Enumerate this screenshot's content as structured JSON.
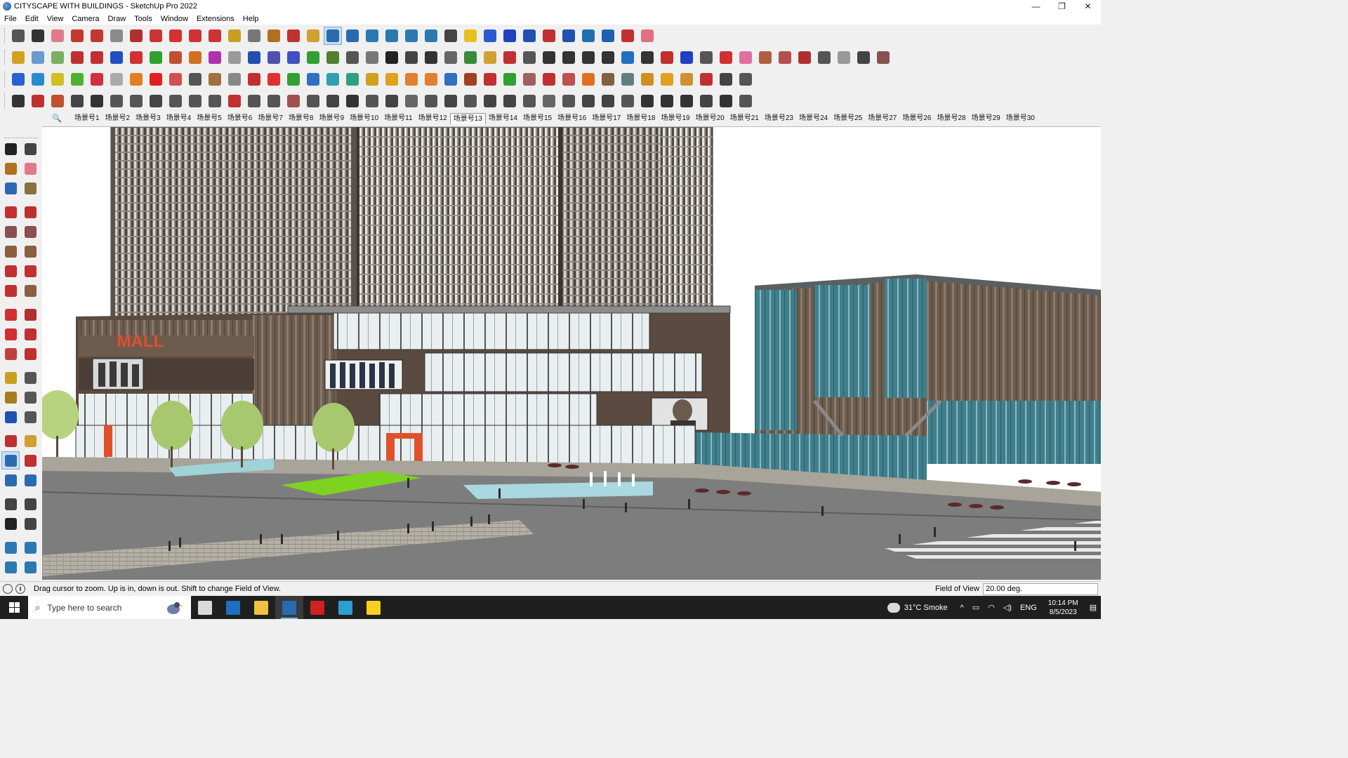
{
  "window": {
    "title": "CITYSCAPE WITH BUILDINGS - SketchUp Pro 2022",
    "minimize": "—",
    "restore": "❐",
    "close": "✕"
  },
  "menu": [
    "File",
    "Edit",
    "View",
    "Camera",
    "Draw",
    "Tools",
    "Window",
    "Extensions",
    "Help"
  ],
  "toolbars": {
    "row1": [
      {
        "name": "zoom-extents-icon",
        "color": "#555555"
      },
      {
        "name": "select-arrow-icon",
        "color": "#333333"
      },
      {
        "name": "eraser-icon",
        "color": "#e07a8a"
      },
      {
        "name": "pencil-icon",
        "color": "#c0392b"
      },
      {
        "name": "lasso-icon",
        "color": "#c0392b"
      },
      {
        "name": "rectangle-icon",
        "color": "#8a8a8a"
      },
      {
        "name": "push-pull-icon",
        "color": "#b03030"
      },
      {
        "name": "follow-me-icon",
        "color": "#cc3333"
      },
      {
        "name": "move-icon",
        "color": "#d63030"
      },
      {
        "name": "rotate-icon",
        "color": "#cc3333"
      },
      {
        "name": "scale-icon",
        "color": "#cc3333"
      },
      {
        "name": "tape-measure-icon",
        "color": "#c8a020"
      },
      {
        "name": "text-icon",
        "color": "#777777"
      },
      {
        "name": "paint-bucket-icon",
        "color": "#b07020"
      },
      {
        "name": "orbit-icon",
        "color": "#c03030"
      },
      {
        "name": "pan-icon",
        "color": "#d0a030"
      },
      {
        "name": "zoom-icon",
        "color": "#2a6ab0"
      },
      {
        "name": "zoom-window-icon",
        "color": "#2a6ab0"
      },
      {
        "name": "warehouse-icon",
        "color": "#2a7ab0"
      },
      {
        "name": "extension-warehouse-icon",
        "color": "#2a7ab0"
      },
      {
        "name": "layout-icon",
        "color": "#2a7ab0"
      },
      {
        "name": "extension-manager-icon",
        "color": "#2a7ab0"
      },
      {
        "name": "user-account-icon",
        "color": "#444444"
      },
      {
        "name": "component-icon",
        "color": "#e8c020"
      },
      {
        "name": "group-icon",
        "color": "#2a5ad0"
      },
      {
        "name": "axes-icon",
        "color": "#2040c0"
      },
      {
        "name": "flip-icon",
        "color": "#2050b0"
      },
      {
        "name": "flip-2-icon",
        "color": "#c03030"
      },
      {
        "name": "dimension-icon",
        "color": "#2050b0"
      },
      {
        "name": "section-plane-icon",
        "color": "#2070b0"
      },
      {
        "name": "undo-icon",
        "color": "#2060b0"
      },
      {
        "name": "redo-icon",
        "color": "#c03030"
      },
      {
        "name": "preferences-icon",
        "color": "#e07080"
      }
    ],
    "row2": [
      {
        "name": "xray-box-icon",
        "color": "#d4a020"
      },
      {
        "name": "back-edges-icon",
        "color": "#6a9ad0"
      },
      {
        "name": "wireframe-box-icon",
        "color": "#7ab060"
      },
      {
        "name": "move-up-icon",
        "color": "#c03030"
      },
      {
        "name": "array-icon",
        "color": "#c03030"
      },
      {
        "name": "array-2-icon",
        "color": "#2050c0"
      },
      {
        "name": "array-r-icon",
        "color": "#d03030"
      },
      {
        "name": "array-g-icon",
        "color": "#30a030"
      },
      {
        "name": "array-n-icon",
        "color": "#c05030"
      },
      {
        "name": "array-x-icon",
        "color": "#d07020"
      },
      {
        "name": "array-f-icon",
        "color": "#b030b0"
      },
      {
        "name": "curve-icon",
        "color": "#999999"
      },
      {
        "name": "wall-icon",
        "color": "#2050b0"
      },
      {
        "name": "wall-2-icon",
        "color": "#5050b0"
      },
      {
        "name": "wall-3-icon",
        "color": "#4050c0"
      },
      {
        "name": "surface-icon",
        "color": "#30a030"
      },
      {
        "name": "terrain-icon",
        "color": "#508030"
      },
      {
        "name": "building-icon",
        "color": "#555555"
      },
      {
        "name": "building-2-icon",
        "color": "#777777"
      },
      {
        "name": "house-icon",
        "color": "#222222"
      },
      {
        "name": "house-2-icon",
        "color": "#444444"
      },
      {
        "name": "house-3-icon",
        "color": "#333333"
      },
      {
        "name": "house-4-icon",
        "color": "#666666"
      },
      {
        "name": "function-icon",
        "color": "#3a8a3a"
      },
      {
        "name": "tag-icon",
        "color": "#d0a030"
      },
      {
        "name": "line-tool-icon",
        "color": "#c03030"
      },
      {
        "name": "shape-icon",
        "color": "#555555"
      },
      {
        "name": "circle-icon",
        "color": "#333333"
      },
      {
        "name": "polygon-icon",
        "color": "#333333"
      },
      {
        "name": "ellipse-icon",
        "color": "#333333"
      },
      {
        "name": "parallelogram-icon",
        "color": "#333333"
      },
      {
        "name": "arc-icon",
        "color": "#2070c0"
      },
      {
        "name": "gear-icon",
        "color": "#333333"
      },
      {
        "name": "ruler-icon",
        "color": "#c03030"
      },
      {
        "name": "spline-icon",
        "color": "#2040c0"
      },
      {
        "name": "spiral-icon",
        "color": "#555555"
      },
      {
        "name": "resize-icon",
        "color": "#d03030"
      },
      {
        "name": "eraser-2-icon",
        "color": "#e070a0"
      },
      {
        "name": "tile-icon",
        "color": "#b06040"
      },
      {
        "name": "grid-icon",
        "color": "#b05050"
      },
      {
        "name": "roof-icon",
        "color": "#b03030"
      },
      {
        "name": "roof-2-icon",
        "color": "#555555"
      },
      {
        "name": "dome-icon",
        "color": "#999999"
      },
      {
        "name": "terrain-2-icon",
        "color": "#444444"
      },
      {
        "name": "terrain-3-icon",
        "color": "#8a5050"
      }
    ],
    "row3": [
      {
        "name": "solid-icon",
        "color": "#2a60d0"
      },
      {
        "name": "plane-icon",
        "color": "#2a8ad0"
      },
      {
        "name": "plane-2-icon",
        "color": "#d0c020"
      },
      {
        "name": "plane-3-icon",
        "color": "#50b030"
      },
      {
        "name": "plane-4-icon",
        "color": "#d03040"
      },
      {
        "name": "plane-5-icon",
        "color": "#aaaaaa"
      },
      {
        "name": "hook-icon",
        "color": "#e08020"
      },
      {
        "name": "stop-icon",
        "color": "#e02020"
      },
      {
        "name": "box-icon",
        "color": "#d05050"
      },
      {
        "name": "flag-icon",
        "color": "#555555"
      },
      {
        "name": "wood-icon",
        "color": "#a07040"
      },
      {
        "name": "bend-icon",
        "color": "#888888"
      },
      {
        "name": "chain-icon",
        "color": "#c03030"
      },
      {
        "name": "cross-red-icon",
        "color": "#e03030"
      },
      {
        "name": "cross-green-icon",
        "color": "#30a030"
      },
      {
        "name": "cross-blue-icon",
        "color": "#3070c0"
      },
      {
        "name": "cone-icon",
        "color": "#30a0b0"
      },
      {
        "name": "cone-2-icon",
        "color": "#30a080"
      },
      {
        "name": "warning-icon",
        "color": "#d0a020"
      },
      {
        "name": "arc-2-icon",
        "color": "#e0a020"
      },
      {
        "name": "arc-3-icon",
        "color": "#e08030"
      },
      {
        "name": "arc-4-icon",
        "color": "#e08030"
      },
      {
        "name": "snap-icon",
        "color": "#3070c0"
      },
      {
        "name": "bucket-icon",
        "color": "#a04020"
      },
      {
        "name": "u-turn-icon",
        "color": "#c03030"
      },
      {
        "name": "tree-icon",
        "color": "#30a030"
      },
      {
        "name": "curve-2-icon",
        "color": "#a06060"
      },
      {
        "name": "curve-3-icon",
        "color": "#c03030"
      },
      {
        "name": "curve-4-icon",
        "color": "#c05050"
      },
      {
        "name": "gem-icon",
        "color": "#e07020"
      },
      {
        "name": "texture-icon",
        "color": "#806040"
      },
      {
        "name": "texture-2-icon",
        "color": "#608080"
      },
      {
        "name": "texture-3-icon",
        "color": "#d09020"
      },
      {
        "name": "texture-4-icon",
        "color": "#e0a020"
      },
      {
        "name": "texture-5-icon",
        "color": "#d09030"
      },
      {
        "name": "points-icon",
        "color": "#c03030"
      },
      {
        "name": "dots-arc-icon",
        "color": "#444444"
      },
      {
        "name": "layers-icon",
        "color": "#555555"
      }
    ],
    "row4": [
      {
        "name": "draw-line-icon",
        "color": "#333333"
      },
      {
        "name": "dashed-line-icon",
        "color": "#c03030"
      },
      {
        "name": "car-icon",
        "color": "#c05030"
      },
      {
        "name": "scissors-icon",
        "color": "#444444"
      },
      {
        "name": "gear-2-icon",
        "color": "#333333"
      },
      {
        "name": "fold-icon",
        "color": "#555555"
      },
      {
        "name": "spring-icon",
        "color": "#555555"
      },
      {
        "name": "sphere-icon",
        "color": "#444444"
      },
      {
        "name": "fold-2-icon",
        "color": "#555555"
      },
      {
        "name": "corner-icon",
        "color": "#555555"
      },
      {
        "name": "corner-2-icon",
        "color": "#555555"
      },
      {
        "name": "slope-icon",
        "color": "#c03030"
      },
      {
        "name": "stair-icon",
        "color": "#555555"
      },
      {
        "name": "arch-icon",
        "color": "#555555"
      },
      {
        "name": "ramp-icon",
        "color": "#a05050"
      },
      {
        "name": "columns-icon",
        "color": "#555555"
      },
      {
        "name": "columns-2-icon",
        "color": "#444444"
      },
      {
        "name": "stack-icon",
        "color": "#333333"
      },
      {
        "name": "stack-2-icon",
        "color": "#555555"
      },
      {
        "name": "stack-3-icon",
        "color": "#444444"
      },
      {
        "name": "stack-4-icon",
        "color": "#666666"
      },
      {
        "name": "stack-5-icon",
        "color": "#555555"
      },
      {
        "name": "fan-icon",
        "color": "#444444"
      },
      {
        "name": "fan-2-icon",
        "color": "#555555"
      },
      {
        "name": "fan-3-icon",
        "color": "#444444"
      },
      {
        "name": "box-2-icon",
        "color": "#444444"
      },
      {
        "name": "slab-icon",
        "color": "#555555"
      },
      {
        "name": "slab-2-icon",
        "color": "#666666"
      },
      {
        "name": "slab-3-icon",
        "color": "#555555"
      },
      {
        "name": "hatch-icon",
        "color": "#444444"
      },
      {
        "name": "hatch-2-icon",
        "color": "#444444"
      },
      {
        "name": "hatch-3-icon",
        "color": "#555555"
      },
      {
        "name": "bars-icon",
        "color": "#333333"
      },
      {
        "name": "sphere-2-icon",
        "color": "#333333"
      },
      {
        "name": "sphere-3-icon",
        "color": "#333333"
      },
      {
        "name": "hatch-4-icon",
        "color": "#444444"
      },
      {
        "name": "hatch-5-icon",
        "color": "#333333"
      },
      {
        "name": "cube-icon",
        "color": "#555555"
      }
    ]
  },
  "scenes": {
    "search_glyph": "🔍",
    "tabs": [
      "场景号1",
      "场景号2",
      "场景号3",
      "场景号4",
      "场景号5",
      "场景号6",
      "场景号7",
      "场景号8",
      "场景号9",
      "场景号10",
      "场景号11",
      "场景号12",
      "场景号13",
      "场景号14",
      "场景号15",
      "场景号16",
      "场景号17",
      "场景号18",
      "场景号19",
      "场景号20",
      "场景号21",
      "场景号23",
      "场景号24",
      "场景号25",
      "场景号27",
      "场景号26",
      "场景号28",
      "场景号29",
      "场景号30"
    ],
    "active_index": 12
  },
  "left_tools": [
    {
      "name": "select-icon",
      "color": "#222222"
    },
    {
      "name": "make-component-icon",
      "color": "#444444"
    },
    {
      "name": "paint-bucket-icon",
      "color": "#b07020"
    },
    {
      "name": "eraser-icon",
      "color": "#e07a8a"
    },
    {
      "name": "tag-tool-icon",
      "color": "#2a6ab0"
    },
    {
      "name": "sample-paint-icon",
      "color": "#8a7040"
    },
    {
      "name": "line-icon",
      "color": "#c03030"
    },
    {
      "name": "freehand-icon",
      "color": "#c03030"
    },
    {
      "name": "rectangle-icon",
      "color": "#8a5050"
    },
    {
      "name": "rotated-rectangle-icon",
      "color": "#8a5050"
    },
    {
      "name": "circle-icon",
      "color": "#8a6040"
    },
    {
      "name": "polygon-icon",
      "color": "#8a6040"
    },
    {
      "name": "arc-icon",
      "color": "#c03030"
    },
    {
      "name": "two-point-arc-icon",
      "color": "#c03030"
    },
    {
      "name": "three-point-arc-icon",
      "color": "#c03030"
    },
    {
      "name": "pie-icon",
      "color": "#8a6040"
    },
    {
      "name": "move-icon",
      "color": "#d03030"
    },
    {
      "name": "push-pull-icon",
      "color": "#b03030"
    },
    {
      "name": "rotate-icon",
      "color": "#d03030"
    },
    {
      "name": "follow-me-icon",
      "color": "#c03030"
    },
    {
      "name": "scale-icon",
      "color": "#c04040"
    },
    {
      "name": "offset-icon",
      "color": "#c03030"
    },
    {
      "name": "tape-measure-icon",
      "color": "#c8a020"
    },
    {
      "name": "dimension-icon",
      "color": "#555555"
    },
    {
      "name": "protractor-icon",
      "color": "#a08020"
    },
    {
      "name": "text-icon",
      "color": "#555555"
    },
    {
      "name": "axes-icon",
      "color": "#2050b0"
    },
    {
      "name": "3d-text-icon",
      "color": "#555555"
    },
    {
      "name": "orbit-icon",
      "color": "#c03030"
    },
    {
      "name": "pan-icon",
      "color": "#d0a030"
    },
    {
      "name": "zoom-icon",
      "color": "#2a6ab0"
    },
    {
      "name": "zoom-window-icon",
      "color": "#c03030"
    },
    {
      "name": "zoom-extents-icon",
      "color": "#2a6ab0"
    },
    {
      "name": "previous-view-icon",
      "color": "#2a6ab0"
    },
    {
      "name": "position-camera-icon",
      "color": "#444444"
    },
    {
      "name": "look-around-icon",
      "color": "#444444"
    },
    {
      "name": "walk-icon",
      "color": "#222222"
    },
    {
      "name": "section-plane-icon",
      "color": "#444444"
    },
    {
      "name": "warehouse-icon",
      "color": "#2a7ab0"
    },
    {
      "name": "extension-warehouse-icon",
      "color": "#2a7ab0"
    },
    {
      "name": "layout-icon",
      "color": "#2a7ab0"
    },
    {
      "name": "extension-manager-icon",
      "color": "#2a7ab0"
    }
  ],
  "status": {
    "message": "Drag cursor to zoom.  Up is in, down is out. Shift to change Field of View.",
    "vcb_label": "Field of View",
    "vcb_value": "20.00 deg."
  },
  "taskbar": {
    "search_placeholder": "Type here to search",
    "search_glyph": "⌕",
    "weather": "31°C  Smoke",
    "tray_up": "^",
    "lang": "ENG",
    "time": "10:14 PM",
    "date": "8/5/2023",
    "apps": [
      {
        "name": "task-view-icon",
        "color": "#d9d9d9"
      },
      {
        "name": "calculator-icon",
        "color": "#1e6fc0"
      },
      {
        "name": "file-explorer-icon",
        "color": "#f0c040"
      },
      {
        "name": "sketchup-icon",
        "color": "#2a6ab0"
      },
      {
        "name": "acrobat-icon",
        "color": "#d02020"
      },
      {
        "name": "edge-icon",
        "color": "#2aa0d0"
      },
      {
        "name": "sticky-notes-icon",
        "color": "#f5d020"
      }
    ]
  },
  "colors": {
    "sky": "#ffffff",
    "tower": "#6b635d",
    "podium": "#5a4a3f",
    "glass": "#3f7f8c",
    "mall_sign": "#e0502c",
    "trees": "#a8c870",
    "ground": "#7a7a7a",
    "plaza": "#a9a69a"
  }
}
